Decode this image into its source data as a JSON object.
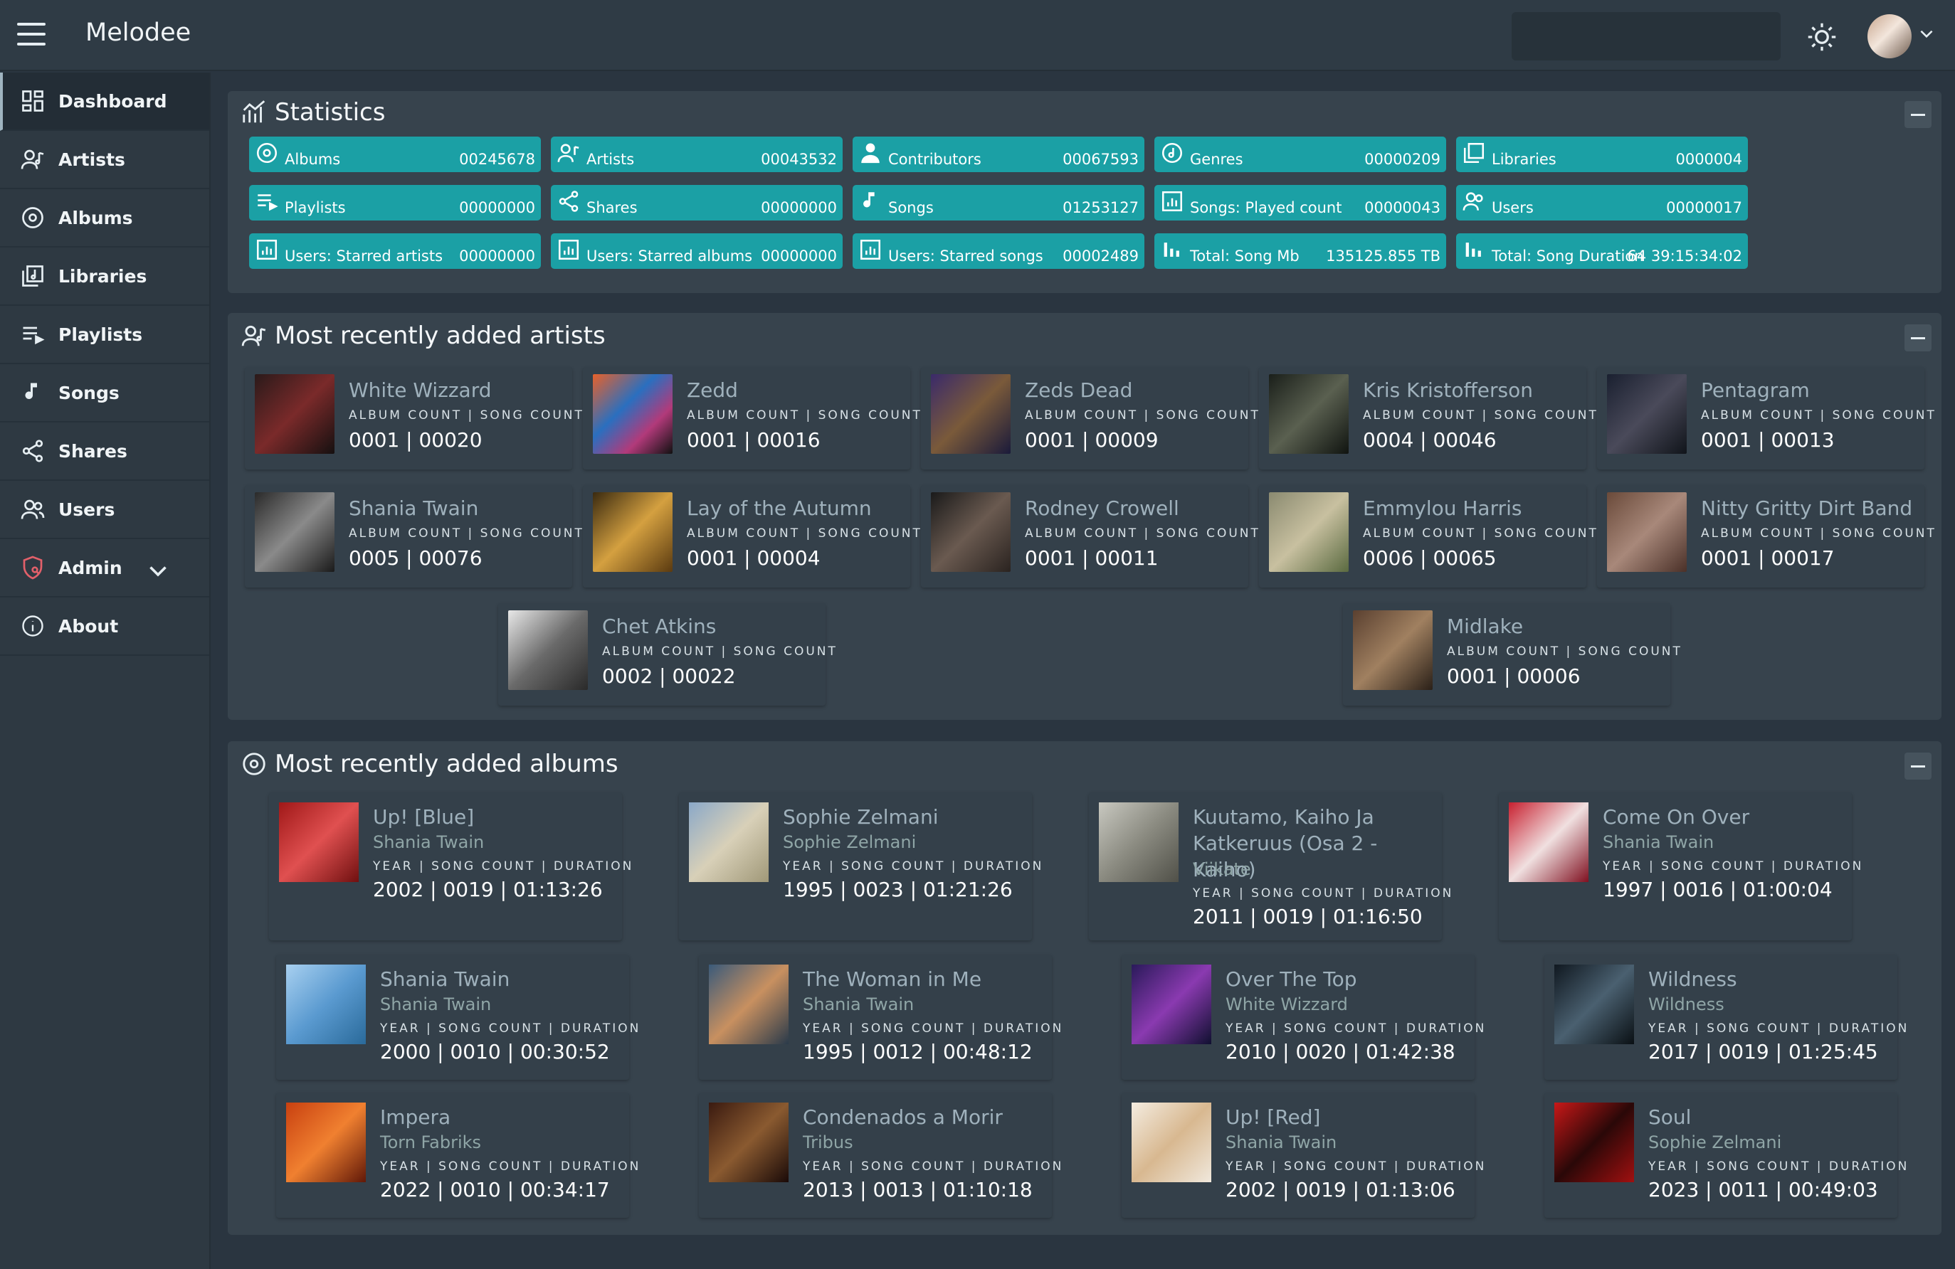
{
  "header": {
    "app_name": "Melodee",
    "search_placeholder": ""
  },
  "sidebar": {
    "items": [
      {
        "label": "Dashboard",
        "icon": "dashboard-icon"
      },
      {
        "label": "Artists",
        "icon": "artist-icon"
      },
      {
        "label": "Albums",
        "icon": "album-icon"
      },
      {
        "label": "Libraries",
        "icon": "library-icon"
      },
      {
        "label": "Playlists",
        "icon": "playlist-icon"
      },
      {
        "label": "Songs",
        "icon": "song-icon"
      },
      {
        "label": "Shares",
        "icon": "share-icon"
      },
      {
        "label": "Users",
        "icon": "users-icon"
      },
      {
        "label": "Admin",
        "icon": "admin-shield-icon"
      },
      {
        "label": "About",
        "icon": "info-icon"
      }
    ]
  },
  "statistics": {
    "title": "Statistics",
    "accent_color": "#1ba0a5",
    "items": [
      {
        "label": "Albums",
        "value": "00245678",
        "icon": "album-icon"
      },
      {
        "label": "Artists",
        "value": "00043532",
        "icon": "artist-icon"
      },
      {
        "label": "Contributors",
        "value": "00067593",
        "icon": "contributor-icon"
      },
      {
        "label": "Genres",
        "value": "00000209",
        "icon": "genre-icon"
      },
      {
        "label": "Libraries",
        "value": "0000004",
        "icon": "library-icon"
      },
      {
        "label": "Playlists",
        "value": "00000000",
        "icon": "playlist-icon"
      },
      {
        "label": "Shares",
        "value": "00000000",
        "icon": "share-icon"
      },
      {
        "label": "Songs",
        "value": "01253127",
        "icon": "song-icon"
      },
      {
        "label": "Songs: Played count",
        "value": "00000043",
        "icon": "chart-icon"
      },
      {
        "label": "Users",
        "value": "00000017",
        "icon": "users-icon"
      },
      {
        "label": "Users: Starred artists",
        "value": "00000000",
        "icon": "chart-icon"
      },
      {
        "label": "Users: Starred albums",
        "value": "00000000",
        "icon": "chart-icon"
      },
      {
        "label": "Users: Starred songs",
        "value": "00002489",
        "icon": "chart-icon"
      },
      {
        "label": "Total: Song Mb",
        "value": "135125.855 TB",
        "icon": "bar-chart-icon"
      },
      {
        "label": "Total: Song Duration",
        "value": "64 39:15:34:02",
        "icon": "bar-chart-icon"
      }
    ]
  },
  "recent_artists": {
    "title": "Most recently added artists",
    "meta_label": "ALBUM COUNT | SONG COUNT",
    "items": [
      {
        "name": "White Wizzard",
        "counts": "0001 | 00020"
      },
      {
        "name": "Zedd",
        "counts": "0001 | 00016"
      },
      {
        "name": "Zeds Dead",
        "counts": "0001 | 00009"
      },
      {
        "name": "Kris Kristofferson",
        "counts": "0004 | 00046"
      },
      {
        "name": "Pentagram",
        "counts": "0001 | 00013"
      },
      {
        "name": "Shania Twain",
        "counts": "0005 | 00076"
      },
      {
        "name": "Lay of the Autumn",
        "counts": "0001 | 00004"
      },
      {
        "name": "Rodney Crowell",
        "counts": "0001 | 00011"
      },
      {
        "name": "Emmylou Harris",
        "counts": "0006 | 00065"
      },
      {
        "name": "Nitty Gritty Dirt Band",
        "counts": "0001 | 00017"
      },
      {
        "name": "Chet Atkins",
        "counts": "0002 | 00022"
      },
      {
        "name": "Midlake",
        "counts": "0001 | 00006"
      }
    ]
  },
  "recent_albums": {
    "title": "Most recently added albums",
    "meta_label": "YEAR | SONG COUNT | DURATION",
    "items": [
      {
        "title": "Up! [Blue]",
        "artist": "Shania Twain",
        "values": "2002 | 0019 | 01:13:26"
      },
      {
        "title": "Sophie Zelmani",
        "artist": "Sophie Zelmani",
        "values": "1995 | 0023 | 01:21:26"
      },
      {
        "title": "Kuutamo, Kaiho Ja Katkeruus (Osa 2 - Kaiho)",
        "artist": "Viikate",
        "values": "2011 | 0019 | 01:16:50"
      },
      {
        "title": "Come On Over",
        "artist": "Shania Twain",
        "values": "1997 | 0016 | 01:00:04"
      },
      {
        "title": "Shania Twain",
        "artist": "Shania Twain",
        "values": "2000 | 0010 | 00:30:52"
      },
      {
        "title": "The Woman in Me",
        "artist": "Shania Twain",
        "values": "1995 | 0012 | 00:48:12"
      },
      {
        "title": "Over The Top",
        "artist": "White Wizzard",
        "values": "2010 | 0020 | 01:42:38"
      },
      {
        "title": "Wildness",
        "artist": "Wildness",
        "values": "2017 | 0019 | 01:25:45"
      },
      {
        "title": "Impera",
        "artist": "Torn Fabriks",
        "values": "2022 | 0010 | 00:34:17"
      },
      {
        "title": "Condenados a Morir",
        "artist": "Tribus",
        "values": "2013 | 0013 | 01:10:18"
      },
      {
        "title": "Up! [Red]",
        "artist": "Shania Twain",
        "values": "2002 | 0019 | 01:13:06"
      },
      {
        "title": "Soul",
        "artist": "Sophie Zelmani",
        "values": "2023 | 0011 | 00:49:03"
      }
    ]
  }
}
